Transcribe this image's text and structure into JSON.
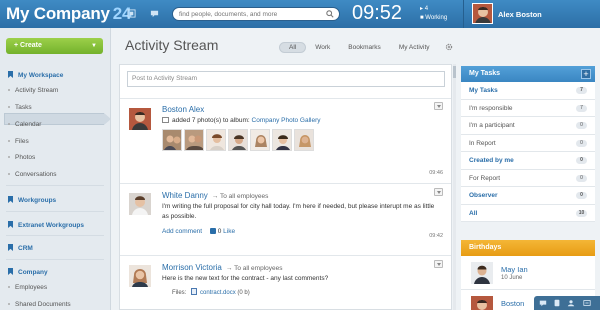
{
  "header": {
    "company": "My Company",
    "company_number": "24",
    "search_placeholder": "find people, documents, and more",
    "clock": "09:52",
    "clock_count": "4",
    "status": "Working",
    "user": "Alex Boston"
  },
  "sidebar": {
    "create_label": "Create",
    "sections": {
      "workspace": "My Workspace",
      "workgroups": "Workgroups",
      "extranet": "Extranet Workgroups",
      "crm": "CRM",
      "company": "Company"
    },
    "items": {
      "activity": "Activity Stream",
      "tasks": "Tasks",
      "calendar": "Calendar",
      "files": "Files",
      "photos": "Photos",
      "conversations": "Conversations",
      "employees": "Employees",
      "shared": "Shared Documents"
    }
  },
  "main": {
    "title": "Activity Stream",
    "tabs": [
      "All",
      "Work",
      "Bookmarks",
      "My Activity"
    ],
    "post_placeholder": "Post to Activity Stream",
    "entries": [
      {
        "name": "Boston Alex",
        "action": "added 7 photo(s) to album:",
        "album": "Company Photo Gallery",
        "time": "09:46"
      },
      {
        "name": "White Danny",
        "to": "To all employees",
        "text": "I'm writing the full proposal for city hall today. I'm here if needed, but please interupt me as little as possible.",
        "add_comment": "Add comment",
        "like_count": "0",
        "like": "Like",
        "time": "09:42"
      },
      {
        "name": "Morrison Victoria",
        "to": "To all employees",
        "text": "Here is the new text for the contract - any last comments?",
        "files_label": "Files:",
        "file_name": "contract.docx",
        "file_size": "(0 b)"
      }
    ]
  },
  "tasks": {
    "title": "My Tasks",
    "items": [
      {
        "label": "My Tasks",
        "count": "7",
        "bold": true
      },
      {
        "label": "I'm responsible",
        "count": "7",
        "bold": false
      },
      {
        "label": "I'm a participant",
        "count": "0",
        "bold": false
      },
      {
        "label": "In Report",
        "count": "0",
        "bold": false
      },
      {
        "label": "Created by me",
        "count": "0",
        "bold": true
      },
      {
        "label": "For Report",
        "count": "0",
        "bold": false
      },
      {
        "label": "Observer",
        "count": "0",
        "bold": true
      },
      {
        "label": "All",
        "count": "10",
        "bold": true
      }
    ]
  },
  "birthdays": {
    "title": "Birthdays",
    "people": [
      {
        "name": "May Ian",
        "date": "10 June"
      },
      {
        "name": "Boston",
        "date": ""
      }
    ]
  },
  "colors": {
    "header": "#3a7db6",
    "accent": "#2a6ea9",
    "create": "#84c03a",
    "birthdays": "#eea41f"
  }
}
